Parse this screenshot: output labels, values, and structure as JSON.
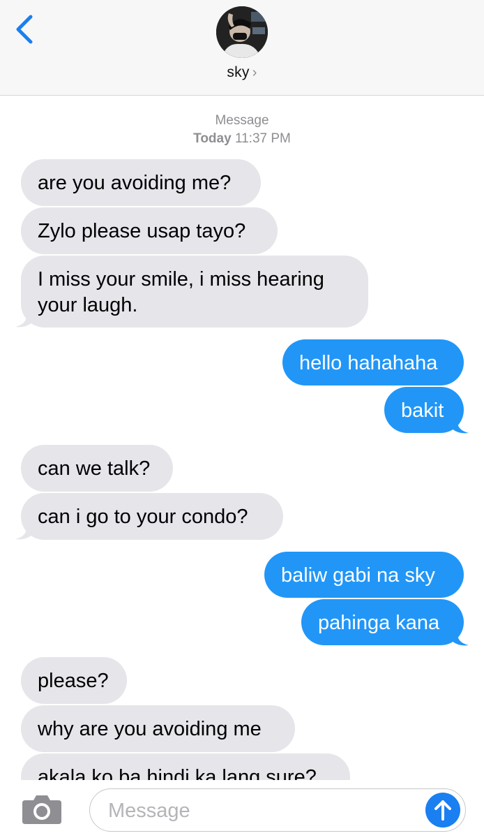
{
  "header": {
    "back_icon": "chevron-left-icon",
    "contact_name": "sky",
    "contact_chevron": "›"
  },
  "thread_meta": {
    "service": "Message",
    "day": "Today",
    "time": "11:37 PM"
  },
  "messages": [
    {
      "direction": "incoming",
      "text": "are you avoiding me?"
    },
    {
      "direction": "incoming",
      "text": "Zylo please usap tayo?"
    },
    {
      "direction": "incoming",
      "line1": "I miss your smile, i miss hearing",
      "line2": "your laugh."
    },
    {
      "direction": "outgoing",
      "text": "hello hahahaha"
    },
    {
      "direction": "outgoing",
      "text": "bakit"
    },
    {
      "direction": "incoming",
      "text": "can we talk?"
    },
    {
      "direction": "incoming",
      "text": "can i go to your condo?"
    },
    {
      "direction": "outgoing",
      "text": "baliw gabi na sky"
    },
    {
      "direction": "outgoing",
      "text": "pahinga kana"
    },
    {
      "direction": "incoming",
      "text": "please?"
    },
    {
      "direction": "incoming",
      "text": "why are you avoiding me"
    },
    {
      "direction": "incoming",
      "text": "akala ko ba hindi ka lang sure?"
    }
  ],
  "composer": {
    "camera_icon": "camera-icon",
    "placeholder": "Message",
    "value": "",
    "send_icon": "arrow-up-icon"
  },
  "colors": {
    "incoming_bubble": "#e5e5ea",
    "outgoing_bubble": "#2196f7",
    "accent": "#1a7ff0",
    "meta_text": "#8e8e93"
  }
}
